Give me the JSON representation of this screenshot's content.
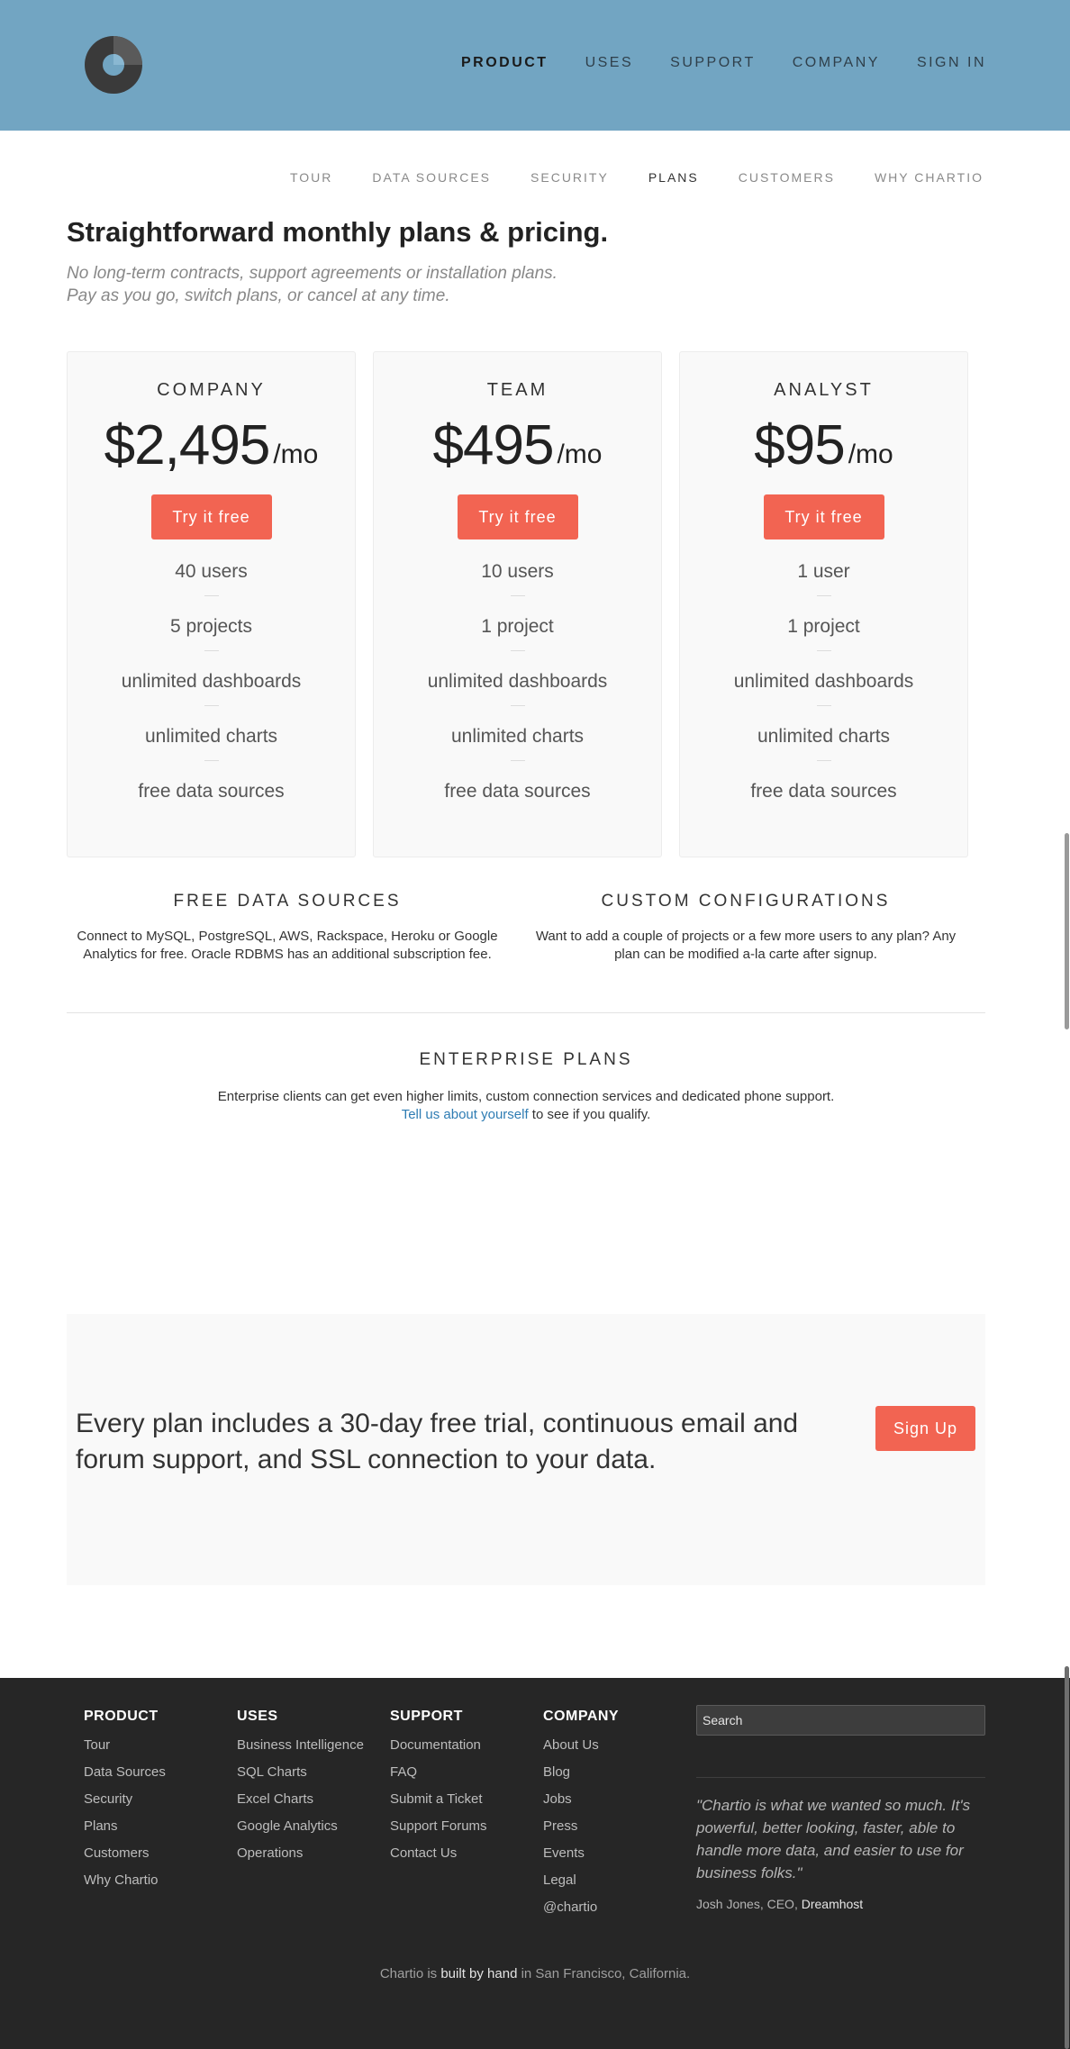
{
  "colors": {
    "header_bg": "#72a5c2",
    "accent": "#f26452",
    "footer_bg": "#262626",
    "link": "#2e7cb3"
  },
  "header": {
    "logo_icon": "chartio-donut-logo",
    "nav": [
      {
        "label": "PRODUCT",
        "active": true
      },
      {
        "label": "USES"
      },
      {
        "label": "SUPPORT"
      },
      {
        "label": "COMPANY"
      },
      {
        "label": "SIGN IN"
      }
    ]
  },
  "subnav": [
    {
      "label": "TOUR"
    },
    {
      "label": "DATA SOURCES"
    },
    {
      "label": "SECURITY"
    },
    {
      "label": "PLANS",
      "active": true
    },
    {
      "label": "CUSTOMERS"
    },
    {
      "label": "WHY CHARTIO"
    }
  ],
  "intro": {
    "title": "Straightforward monthly plans & pricing.",
    "subtitle_line1": "No long-term contracts, support agreements or installation plans.",
    "subtitle_line2": "Pay as you go, switch plans, or cancel at any time."
  },
  "plans": [
    {
      "name": "COMPANY",
      "price": "$2,495",
      "period": "/mo",
      "cta": "Try it free",
      "features": [
        "40 users",
        "5 projects",
        "unlimited dashboards",
        "unlimited charts",
        "free data sources"
      ]
    },
    {
      "name": "TEAM",
      "price": "$495",
      "period": "/mo",
      "cta": "Try it free",
      "features": [
        "10 users",
        "1 project",
        "unlimited dashboards",
        "unlimited charts",
        "free data sources"
      ]
    },
    {
      "name": "ANALYST",
      "price": "$95",
      "period": "/mo",
      "cta": "Try it free",
      "features": [
        "1 user",
        "1 project",
        "unlimited dashboards",
        "unlimited charts",
        "free data sources"
      ]
    }
  ],
  "info": {
    "free_sources": {
      "title": "FREE DATA SOURCES",
      "line1": "Connect to MySQL, PostgreSQL, AWS, Rackspace, Heroku or Google",
      "line2": "Analytics for free. Oracle RDBMS has an additional subscription fee."
    },
    "custom": {
      "title": "CUSTOM CONFIGURATIONS",
      "line1": "Want to add a couple of projects or a few more users to any plan? Any",
      "line2": "plan can be modified a-la carte after signup."
    }
  },
  "enterprise": {
    "title": "ENTERPRISE PLANS",
    "line1": "Enterprise clients can get even higher limits, custom connection services and dedicated phone support.",
    "link": "Tell us about yourself",
    "line2_rest": " to see if you qualify."
  },
  "trial": {
    "line1": "Every plan includes a 30-day free trial, continuous email and",
    "line2": "forum support, and SSL connection to your data.",
    "cta": "Sign Up"
  },
  "footer": {
    "columns": [
      {
        "title": "PRODUCT",
        "items": [
          "Tour",
          "Data Sources",
          "Security",
          "Plans",
          "Customers",
          "Why Chartio"
        ]
      },
      {
        "title": "USES",
        "items": [
          "Business Intelligence",
          "SQL Charts",
          "Excel Charts",
          "Google Analytics",
          "Operations"
        ]
      },
      {
        "title": "SUPPORT",
        "items": [
          "Documentation",
          "FAQ",
          "Submit a Ticket",
          "Support Forums",
          "Contact Us"
        ]
      },
      {
        "title": "COMPANY",
        "items": [
          "About Us",
          "Blog",
          "Jobs",
          "Press",
          "Events",
          "Legal",
          "@chartio"
        ]
      }
    ],
    "search_placeholder": "Search",
    "quote": "\"Chartio is what we wanted so much. It's powerful, better looking, faster, able to handle more data, and easier to use for business folks.\"",
    "quote_author": "Josh Jones, CEO, ",
    "quote_org": "Dreamhost",
    "credit": {
      "part1": "Chartio is ",
      "part2": "built by hand",
      "part3": " in San Francisco, California."
    }
  }
}
